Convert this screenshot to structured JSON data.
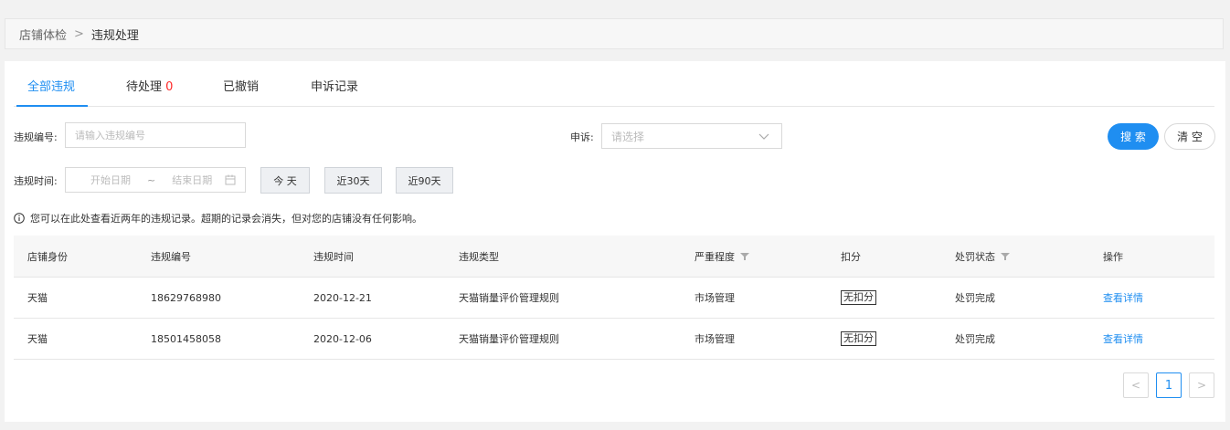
{
  "breadcrumb": {
    "parent": "店铺体检",
    "separator": ">",
    "current": "违规处理"
  },
  "tabs": [
    {
      "label": "全部违规",
      "active": true
    },
    {
      "label": "待处理",
      "count": "0"
    },
    {
      "label": "已撤销"
    },
    {
      "label": "申诉记录"
    }
  ],
  "filters": {
    "violation_id_label": "违规编号:",
    "violation_id_placeholder": "请输入违规编号",
    "appeal_label": "申诉:",
    "appeal_placeholder": "请选择",
    "time_label": "违规时间:",
    "start_date_placeholder": "开始日期",
    "date_separator": "~",
    "end_date_placeholder": "结束日期",
    "quick_dates": [
      "今 天",
      "近30天",
      "近90天"
    ]
  },
  "buttons": {
    "search": "搜 索",
    "clear": "清 空"
  },
  "notice": "您可以在此处查看近两年的违规记录。超期的记录会消失，但对您的店铺没有任何影响。",
  "table": {
    "headers": [
      "店铺身份",
      "违规编号",
      "违规时间",
      "违规类型",
      "严重程度",
      "扣分",
      "处罚状态",
      "操作"
    ],
    "rows": [
      [
        "天猫",
        "18629768980",
        "2020-12-21",
        "天猫销量评价管理规则",
        "市场管理",
        "无扣分",
        "处罚完成",
        "查看详情"
      ],
      [
        "天猫",
        "18501458058",
        "2020-12-06",
        "天猫销量评价管理规则",
        "市场管理",
        "无扣分",
        "处罚完成",
        "查看详情"
      ]
    ]
  },
  "pagination": {
    "prev": "<",
    "current": "1",
    "next": ">"
  },
  "colors": {
    "accent": "#1f8ef1",
    "count": "#ff2a2a"
  }
}
